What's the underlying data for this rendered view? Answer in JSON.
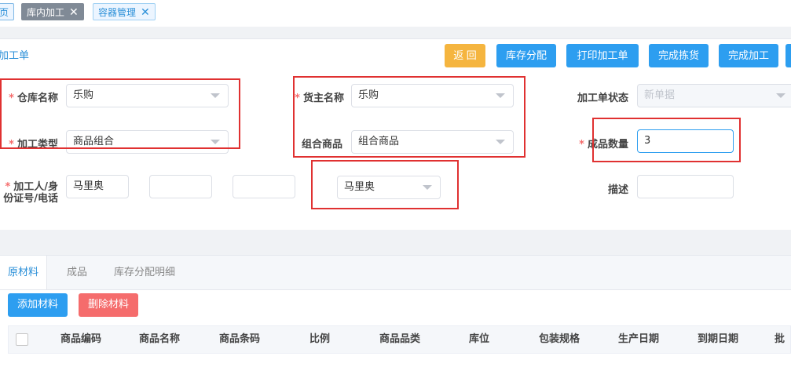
{
  "tabs": {
    "home": "页",
    "processing": "库内加工",
    "container": "容器管理",
    "close_glyph": "✕"
  },
  "header": {
    "title": "加工单",
    "buttons": {
      "back": "返 回",
      "allocate": "库存分配",
      "print": "打印加工单",
      "finish_pick": "完成拣货",
      "finish_process": "完成加工"
    }
  },
  "form": {
    "required_mark": "*",
    "warehouse": {
      "label": "仓库名称",
      "value": "乐购"
    },
    "owner": {
      "label": "货主名称",
      "value": "乐购"
    },
    "status": {
      "label": "加工单状态",
      "value": "新单据"
    },
    "process_type": {
      "label": "加工类型",
      "value": "商品组合"
    },
    "combo_goods": {
      "label": "组合商品",
      "value": "组合商品"
    },
    "product_qty": {
      "label": "成品数量",
      "value": "3"
    },
    "processor": {
      "label_line1": "加工人/身",
      "label_line2": "份证号/电话",
      "name": "马里奥",
      "id_no": "",
      "phone": "",
      "select_value": "马里奥"
    },
    "description": {
      "label": "描述",
      "value": ""
    }
  },
  "lower": {
    "tabs": [
      "原材料",
      "成品",
      "库存分配明细"
    ],
    "add_button": "添加材料",
    "delete_button": "删除材料",
    "columns": [
      "商品编码",
      "商品名称",
      "商品条码",
      "比例",
      "商品品类",
      "库位",
      "包装规格",
      "生产日期",
      "到期日期",
      "批"
    ]
  },
  "colors": {
    "primary": "#2d9ef0",
    "warning": "#f5b53f",
    "danger": "#f56c6c",
    "annotation": "#e03131"
  }
}
